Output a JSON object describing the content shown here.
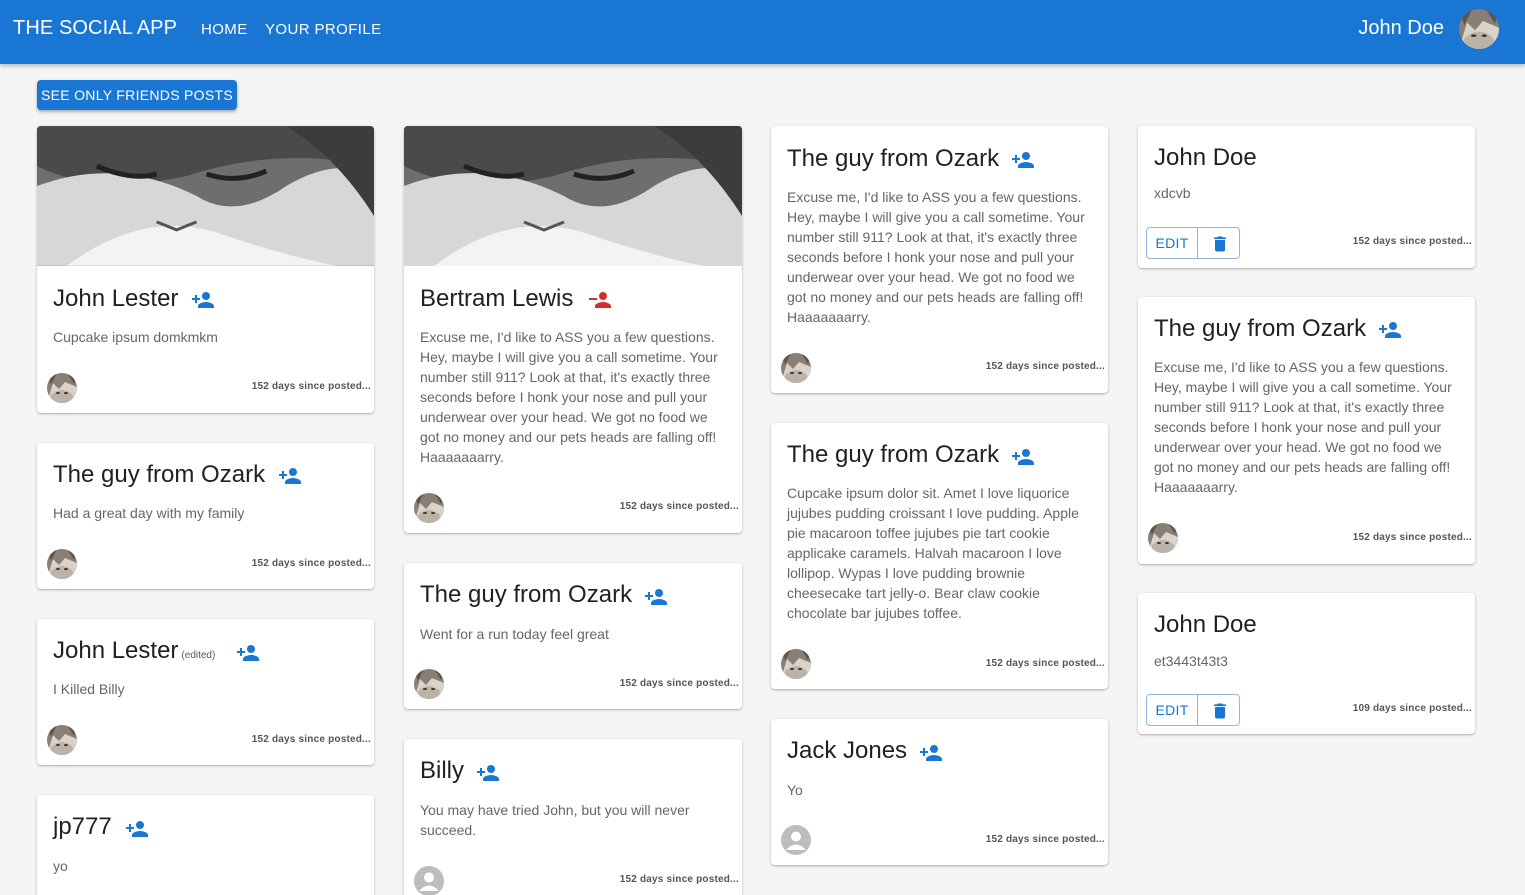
{
  "appbar": {
    "brand": "THE SOCIAL APP",
    "nav": [
      "HOME",
      "YOUR PROFILE"
    ],
    "user_name": "John Doe"
  },
  "filter_button": "SEE ONLY FRIENDS POSTS",
  "colors": {
    "primary": "#1976d2",
    "remove_friend": "#d32f2f",
    "background": "#f5f5f5"
  },
  "posts": [
    {
      "author": "John Lester",
      "text": "Cupcake ipsum domkmkm",
      "days": "152 days since posted...",
      "friend_icon": "add-friend-icon"
    },
    {
      "author": "The guy from Ozark",
      "text": "Had a great day with my family",
      "days": "152 days since posted...",
      "friend_icon": "add-friend-icon"
    },
    {
      "author": "John Lester",
      "edited": "(edited)",
      "text": "I Killed Billy",
      "days": "152 days since posted...",
      "friend_icon": "add-friend-icon"
    },
    {
      "author": "jp777",
      "text": "yo",
      "friend_icon": "add-friend-icon"
    },
    {
      "author": "Bertram Lewis",
      "text": "Excuse me, I'd like to ASS you a few questions. Hey, maybe I will give you a call sometime. Your number still 911? Look at that, it's exactly three seconds before I honk your nose and pull your underwear over your head. We got no food we got no money and our pets heads are falling off! Haaaaaaarry.",
      "days": "152 days since posted...",
      "friend_icon": "remove-friend-icon"
    },
    {
      "author": "The guy from Ozark",
      "text": "Went for a run today feel great",
      "days": "152 days since posted...",
      "friend_icon": "add-friend-icon"
    },
    {
      "author": "Billy",
      "text": "You may have tried John, but you will never succeed.",
      "days": "152 days since posted...",
      "friend_icon": "add-friend-icon"
    },
    {
      "author": "The guy from Ozark",
      "text": "Excuse me, I'd like to ASS you a few questions. Hey, maybe I will give you a call sometime. Your number still 911? Look at that, it's exactly three seconds before I honk your nose and pull your underwear over your head. We got no food we got no money and our pets heads are falling off! Haaaaaaarry.",
      "days": "152 days since posted...",
      "friend_icon": "add-friend-icon"
    },
    {
      "author": "The guy from Ozark",
      "text": "Cupcake ipsum dolor sit. Amet I love liquorice jujubes pudding croissant I love pudding. Apple pie macaroon toffee jujubes pie tart cookie applicake caramels. Halvah macaroon I love lollipop. Wypas I love pudding brownie cheesecake tart jelly-o. Bear claw cookie chocolate bar jujubes toffee.",
      "days": "152 days since posted...",
      "friend_icon": "add-friend-icon"
    },
    {
      "author": "Jack Jones",
      "text": "Yo",
      "days": "152 days since posted...",
      "friend_icon": "add-friend-icon"
    },
    {
      "author": "John Doe",
      "text": "xdcvb",
      "days": "152 days since posted...",
      "edit_label": "EDIT"
    },
    {
      "author": "The guy from Ozark",
      "text": "Excuse me, I'd like to ASS you a few questions. Hey, maybe I will give you a call sometime. Your number still 911? Look at that, it's exactly three seconds before I honk your nose and pull your underwear over your head. We got no food we got no money and our pets heads are falling off! Haaaaaaarry.",
      "days": "152 days since posted...",
      "friend_icon": "add-friend-icon"
    },
    {
      "author": "John Doe",
      "text": "et3443t43t3",
      "days": "109 days since posted...",
      "edit_label": "EDIT"
    }
  ]
}
